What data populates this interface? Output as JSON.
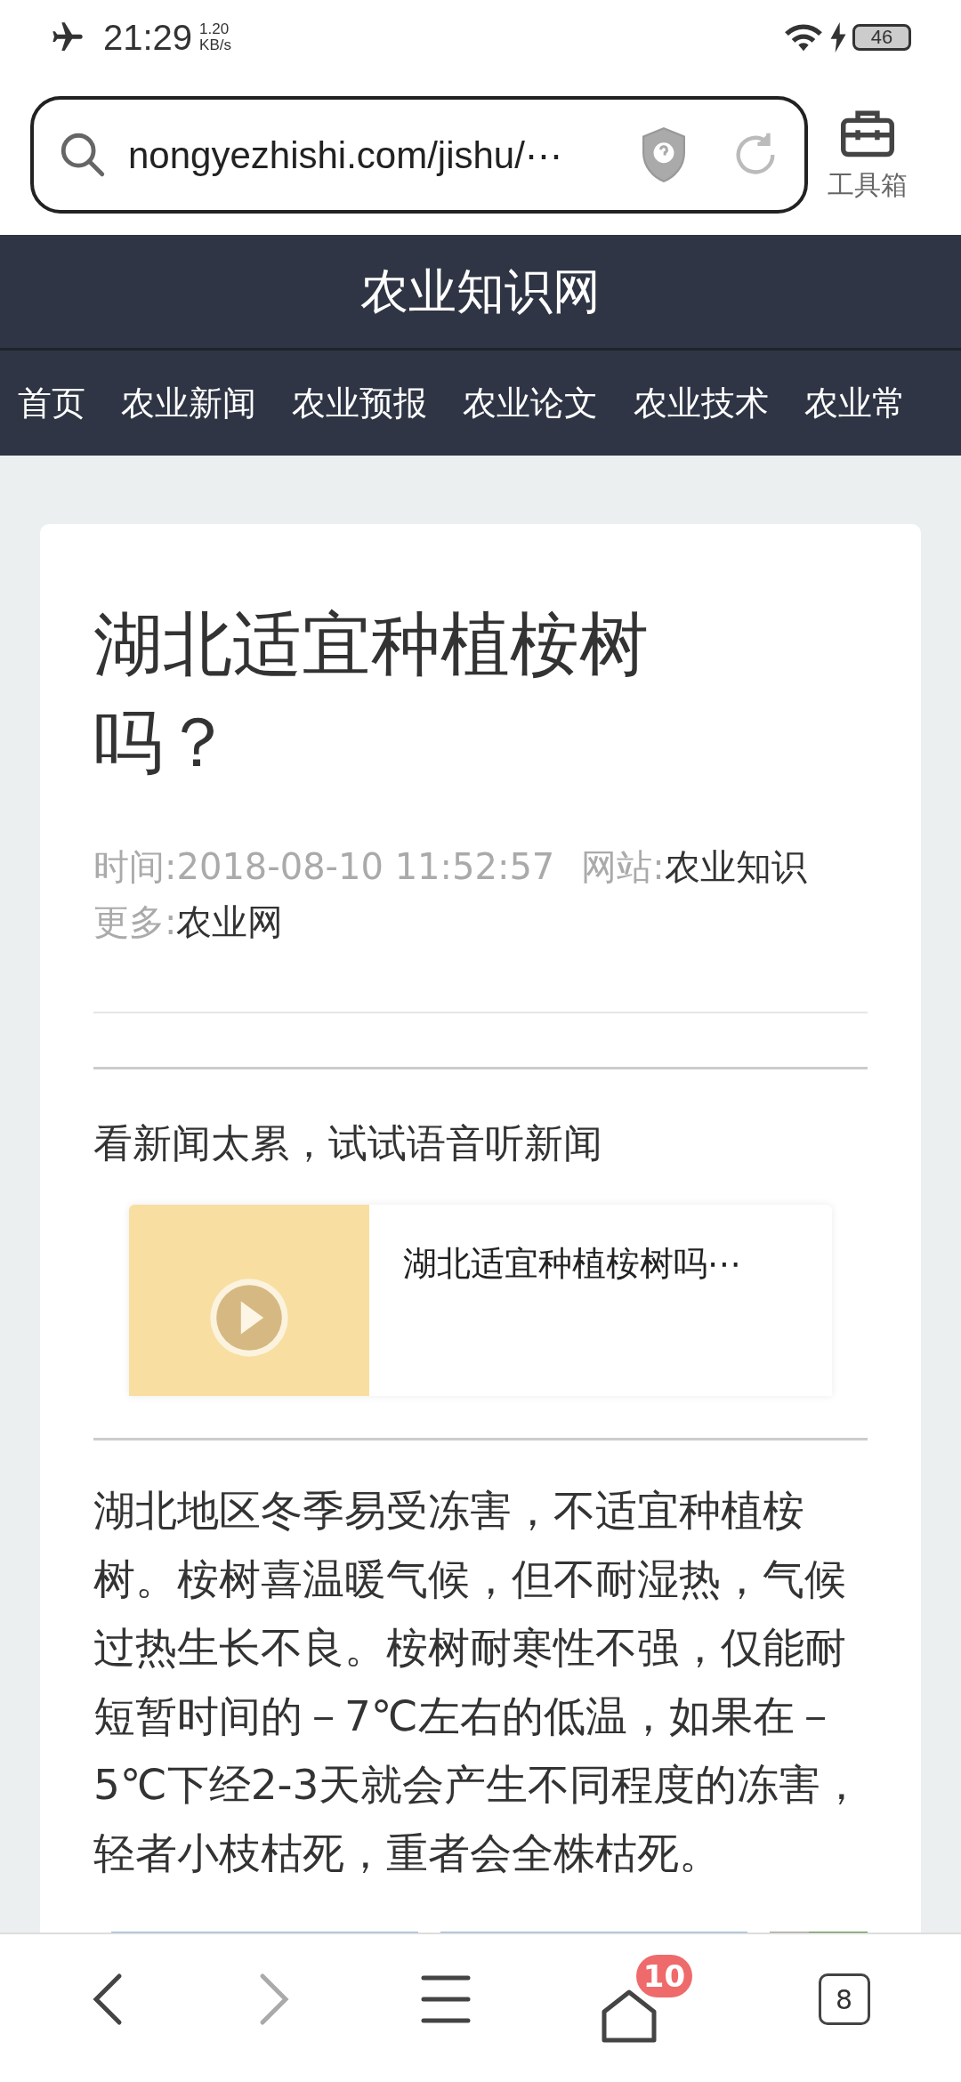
{
  "status_bar": {
    "time": "21:29",
    "speed_value": "1.20",
    "speed_unit": "KB/s",
    "battery": "46"
  },
  "address_bar": {
    "url": "nongyezhishi.com/jishu/⋯",
    "toolbox_label": "工具箱"
  },
  "site": {
    "title": "农业知识网"
  },
  "nav": [
    {
      "label": "首页"
    },
    {
      "label": "农业新闻"
    },
    {
      "label": "农业预报"
    },
    {
      "label": "农业论文"
    },
    {
      "label": "农业技术"
    },
    {
      "label": "农业常"
    }
  ],
  "article": {
    "title": "湖北适宜种植桉树吗？",
    "time_label": "时间:",
    "time": "2018-08-10 11:52:57",
    "site_label": "网站:",
    "site": "农业知识",
    "more_label": "更多:",
    "more": "农业网",
    "listen_prompt": "看新闻太累，试试语音听新闻",
    "audio_title": "湖北适宜种植桉树吗⋯",
    "body": "湖北地区冬季易受冻害，不适宜种植桉树。桉树喜温暖气候，但不耐湿热，气候过热生长不良。桉树耐寒性不强，仅能耐短暂时间的－7℃左右的低温，如果在－5℃下经2-3天就会产生不同程度的冻害，轻者小枝枯死，重者会全株枯死。"
  },
  "bottom_bar": {
    "home_badge": "10",
    "tabs_count": "8"
  }
}
